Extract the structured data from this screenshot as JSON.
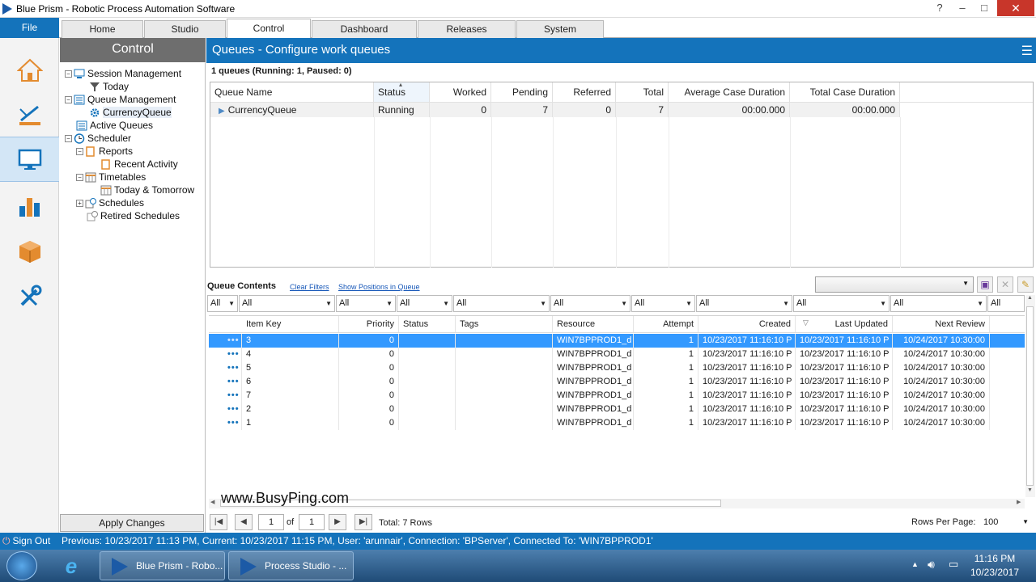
{
  "window": {
    "title": "Blue Prism - Robotic Process Automation Software"
  },
  "menu": {
    "file": "File"
  },
  "tabs": [
    "Home",
    "Studio",
    "Control",
    "Dashboard",
    "Releases",
    "System"
  ],
  "nav_icons": [
    "home-icon",
    "studio-icon",
    "control-icon",
    "dashboard-icon",
    "releases-icon",
    "system-icon"
  ],
  "control_panel": {
    "title": "Control",
    "tree": [
      {
        "label": "Session Management",
        "icon": "session-icon"
      },
      {
        "label": "Today",
        "icon": "filter-icon"
      },
      {
        "label": "Queue Management",
        "icon": "queue-icon"
      },
      {
        "label": "CurrencyQueue",
        "icon": "gear-icon"
      },
      {
        "label": "Active Queues",
        "icon": "queue-icon"
      },
      {
        "label": "Scheduler",
        "icon": "clock-icon"
      },
      {
        "label": "Reports",
        "icon": "report-icon"
      },
      {
        "label": "Recent Activity",
        "icon": "report-icon"
      },
      {
        "label": "Timetables",
        "icon": "table-icon"
      },
      {
        "label": "Today & Tomorrow",
        "icon": "table-icon"
      },
      {
        "label": "Schedules",
        "icon": "schedule-icon"
      },
      {
        "label": "Retired Schedules",
        "icon": "schedule-icon"
      }
    ],
    "apply": "Apply Changes"
  },
  "main": {
    "title": "Queues - Configure work queues",
    "summary": "1 queues (Running: 1, Paused: 0)",
    "queue_columns": [
      "Queue Name",
      "Status",
      "Worked",
      "Pending",
      "Referred",
      "Total",
      "Average Case Duration",
      "Total Case Duration"
    ],
    "queue_rows": [
      {
        "name": "CurrencyQueue",
        "status": "Running",
        "worked": "0",
        "pending": "7",
        "referred": "0",
        "total": "7",
        "avg": "00:00.000",
        "total_dur": "00:00.000"
      }
    ]
  },
  "queue_contents": {
    "label": "Queue Contents",
    "clear_filters": "Clear Filters",
    "show_positions": "Show Positions in Queue",
    "filters": [
      "All",
      "All",
      "All",
      "All",
      "All",
      "All",
      "All",
      "All",
      "All",
      "All",
      "All"
    ],
    "columns": [
      "Item Key",
      "Priority",
      "Status",
      "Tags",
      "Resource",
      "Attempt",
      "Created",
      "Last Updated",
      "Next Review"
    ],
    "rows": [
      {
        "key": "3",
        "priority": "0",
        "status": "",
        "tags": "",
        "resource": "WIN7BPPROD1_d",
        "attempt": "1",
        "created": "10/23/2017 11:16:10 P",
        "updated": "10/23/2017 11:16:10 P",
        "review": "10/24/2017 10:30:00"
      },
      {
        "key": "4",
        "priority": "0",
        "status": "",
        "tags": "",
        "resource": "WIN7BPPROD1_d",
        "attempt": "1",
        "created": "10/23/2017 11:16:10 P",
        "updated": "10/23/2017 11:16:10 P",
        "review": "10/24/2017 10:30:00"
      },
      {
        "key": "5",
        "priority": "0",
        "status": "",
        "tags": "",
        "resource": "WIN7BPPROD1_d",
        "attempt": "1",
        "created": "10/23/2017 11:16:10 P",
        "updated": "10/23/2017 11:16:10 P",
        "review": "10/24/2017 10:30:00"
      },
      {
        "key": "6",
        "priority": "0",
        "status": "",
        "tags": "",
        "resource": "WIN7BPPROD1_d",
        "attempt": "1",
        "created": "10/23/2017 11:16:10 P",
        "updated": "10/23/2017 11:16:10 P",
        "review": "10/24/2017 10:30:00"
      },
      {
        "key": "7",
        "priority": "0",
        "status": "",
        "tags": "",
        "resource": "WIN7BPPROD1_d",
        "attempt": "1",
        "created": "10/23/2017 11:16:10 P",
        "updated": "10/23/2017 11:16:10 P",
        "review": "10/24/2017 10:30:00"
      },
      {
        "key": "2",
        "priority": "0",
        "status": "",
        "tags": "",
        "resource": "WIN7BPPROD1_d",
        "attempt": "1",
        "created": "10/23/2017 11:16:10 P",
        "updated": "10/23/2017 11:16:10 P",
        "review": "10/24/2017 10:30:00"
      },
      {
        "key": "1",
        "priority": "0",
        "status": "",
        "tags": "",
        "resource": "WIN7BPPROD1_d",
        "attempt": "1",
        "created": "10/23/2017 11:16:10 P",
        "updated": "10/23/2017 11:16:10 P",
        "review": "10/24/2017 10:30:00"
      }
    ]
  },
  "pager": {
    "page": "1",
    "of": "of",
    "total_pages": "1",
    "total": "Total: 7 Rows",
    "rows_per_page_label": "Rows Per Page:",
    "rows_per_page": "100"
  },
  "watermark": "www.BusyPing.com",
  "status": {
    "signout": "Sign Out",
    "text": "Previous: 10/23/2017 11:13 PM, Current: 10/23/2017 11:15 PM, User: 'arunnair', Connection: 'BPServer', Connected To: 'WIN7BPPROD1'"
  },
  "taskbar": {
    "items": [
      "Blue Prism - Robo...",
      "Process Studio - ..."
    ],
    "time": "11:16 PM",
    "date": "10/23/2017"
  },
  "colors": {
    "accent": "#1473bb",
    "selection": "#3399ff"
  }
}
